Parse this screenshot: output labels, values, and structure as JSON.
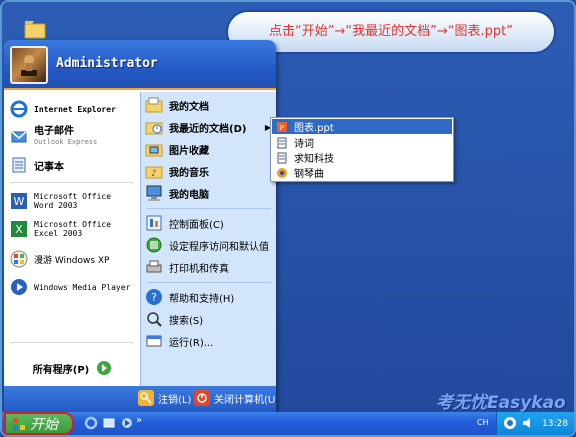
{
  "instruction_banner": "点击“开始”→“我最近的文档”→“图表.ppt”",
  "user": {
    "name": "Administrator"
  },
  "left_pinned": [
    {
      "label": "Internet Explorer",
      "icon": "internet-explorer-icon"
    },
    {
      "label": "电子邮件",
      "sublabel": "Outlook Express",
      "icon": "outlook-express-icon"
    },
    {
      "label": "记事本",
      "icon": "notepad-icon"
    }
  ],
  "left_recent": [
    {
      "label": "Microsoft Office Word 2003",
      "icon": "word-icon"
    },
    {
      "label": "Microsoft Office Excel 2003",
      "icon": "excel-icon"
    },
    {
      "label": "漫游 Windows XP",
      "icon": "tour-xp-icon"
    },
    {
      "label": "Windows Media Player",
      "icon": "media-player-icon"
    }
  ],
  "all_programs": "所有程序(P)",
  "right_items": [
    {
      "label": "我的文档",
      "bold": true,
      "icon": "my-documents-icon"
    },
    {
      "label": "我最近的文档(D)",
      "bold": true,
      "icon": "recent-documents-icon",
      "submenu": true
    },
    {
      "label": "图片收藏",
      "bold": true,
      "icon": "my-pictures-icon"
    },
    {
      "label": "我的音乐",
      "bold": true,
      "icon": "my-music-icon"
    },
    {
      "label": "我的电脑",
      "bold": true,
      "icon": "my-computer-icon"
    },
    {
      "label": "控制面板(C)",
      "bold": false,
      "icon": "control-panel-icon"
    },
    {
      "label": "设定程序访问和默认值",
      "bold": false,
      "icon": "program-access-icon"
    },
    {
      "label": "打印机和传真",
      "bold": false,
      "icon": "printers-icon"
    },
    {
      "label": "帮助和支持(H)",
      "bold": false,
      "icon": "help-icon"
    },
    {
      "label": "搜索(S)",
      "bold": false,
      "icon": "search-icon"
    },
    {
      "label": "运行(R)...",
      "bold": false,
      "icon": "run-icon"
    }
  ],
  "submenu_items": [
    {
      "label": "图表.ppt",
      "icon": "powerpoint-file-icon",
      "selected": true
    },
    {
      "label": "诗词",
      "icon": "text-file-icon",
      "selected": false
    },
    {
      "label": "求知科技",
      "icon": "text-file-icon",
      "selected": false
    },
    {
      "label": "钢琴曲",
      "icon": "audio-file-icon",
      "selected": false
    }
  ],
  "footer": {
    "logoff": "注销(L)",
    "shutdown": "关闭计算机(U)"
  },
  "taskbar": {
    "start": "开始",
    "quicklaunch_more": "»",
    "lang": "CH",
    "clock": "13:28"
  },
  "watermark": "考无忧Easykao",
  "colors": {
    "banner_text": "#e5322d",
    "selection": "#316ac5",
    "start_button_outline": "#d81e1e"
  }
}
